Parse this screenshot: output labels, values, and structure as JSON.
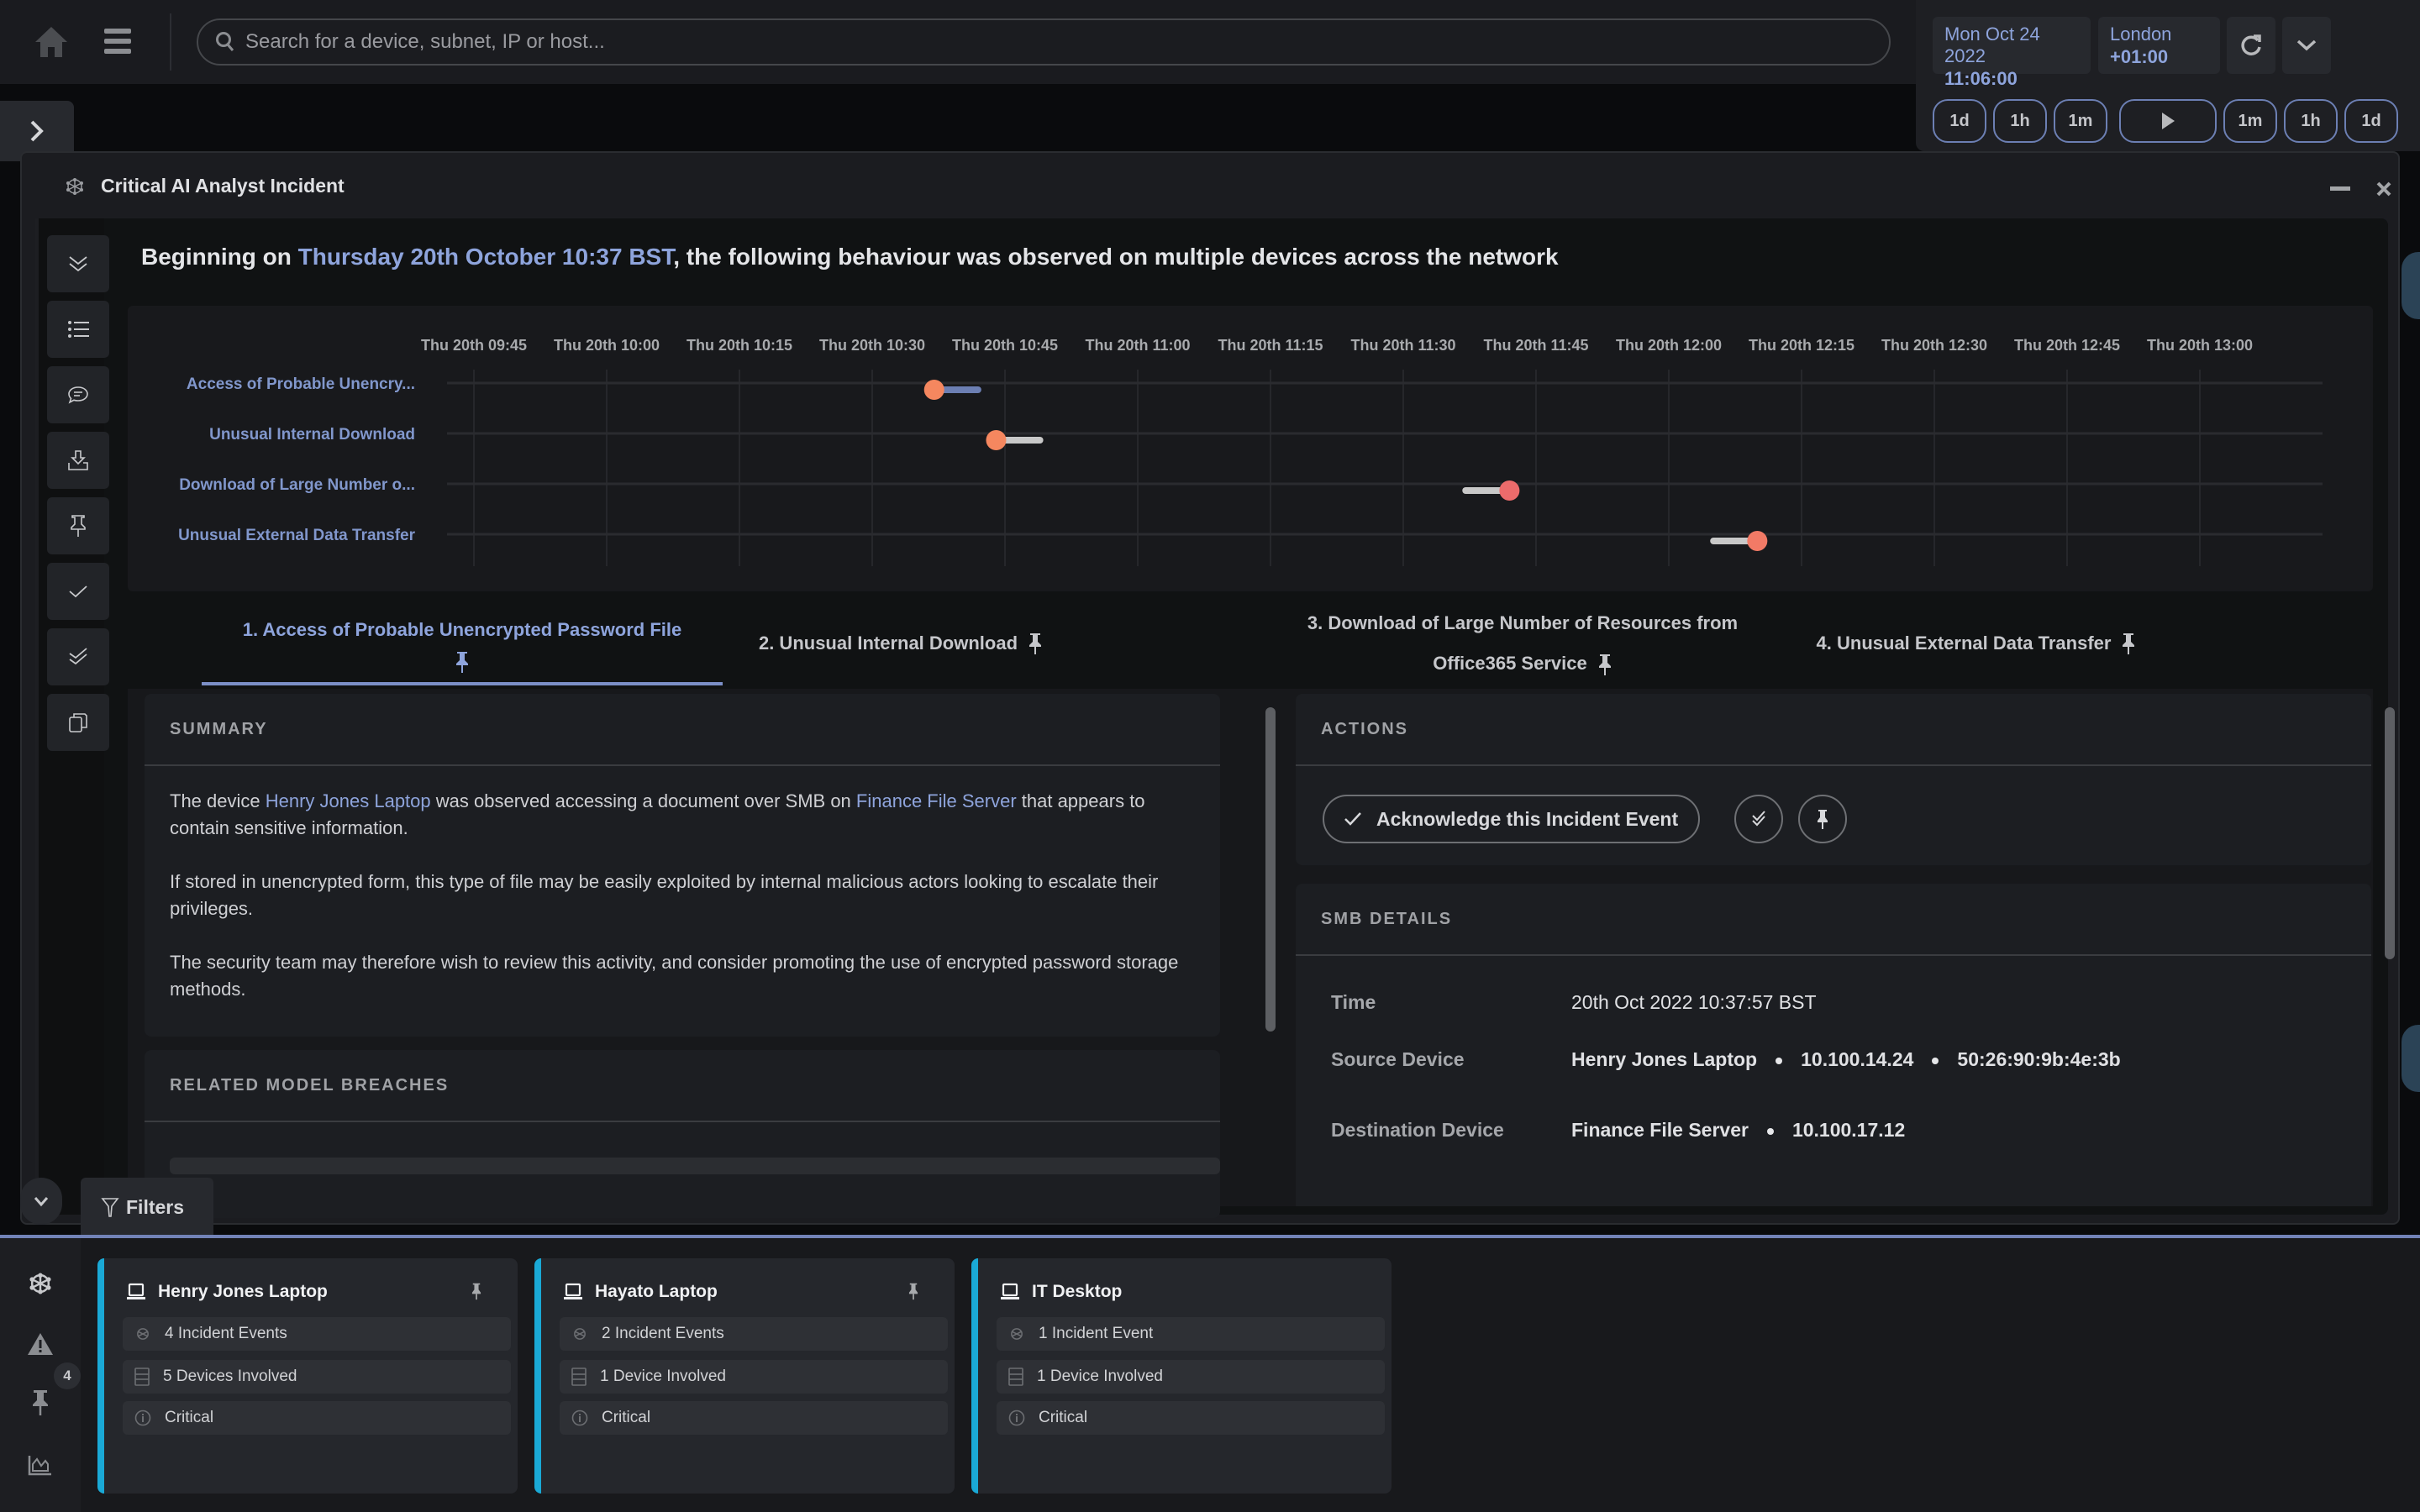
{
  "topbar": {
    "search_placeholder": "Search for a device, subnet, IP or host...",
    "date": "Mon Oct 24 2022",
    "time": "11:06:00",
    "timezone_city": "London",
    "timezone_offset": "+01:00",
    "step_back": [
      "1d",
      "1h",
      "1m"
    ],
    "step_forward": [
      "1m",
      "1h",
      "1d"
    ]
  },
  "modal": {
    "title": "Critical AI Analyst Incident",
    "headline_prefix": "Beginning on ",
    "headline_date": "Thursday 20th October 10:37 BST",
    "headline_suffix": ", the following behaviour was observed on multiple devices across the network"
  },
  "chart_data": {
    "type": "timeline",
    "x_ticks": [
      "Thu 20th 09:45",
      "Thu 20th 10:00",
      "Thu 20th 10:15",
      "Thu 20th 10:30",
      "Thu 20th 10:45",
      "Thu 20th 11:00",
      "Thu 20th 11:15",
      "Thu 20th 11:30",
      "Thu 20th 11:45",
      "Thu 20th 12:00",
      "Thu 20th 12:15",
      "Thu 20th 12:30",
      "Thu 20th 12:45",
      "Thu 20th 13:00"
    ],
    "x_range_minutes": [
      0,
      195
    ],
    "categories": [
      "Access of Probable Unencry...",
      "Unusual Internal Download",
      "Download of Large Number o...",
      "Unusual External Data Transfer"
    ],
    "events": [
      {
        "category": 0,
        "start_min": 52,
        "end_min": 56,
        "marker": "start",
        "marker_color": "#f5875f",
        "bar_color": "#6c7fb3"
      },
      {
        "category": 1,
        "start_min": 59,
        "end_min": 63,
        "marker": "start",
        "marker_color": "#f5875f",
        "bar_color": "#c8c8c8"
      },
      {
        "category": 2,
        "start_min": 113,
        "end_min": 117,
        "marker": "end",
        "marker_color": "#ec6b6b",
        "bar_color": "#c8c8c8"
      },
      {
        "category": 3,
        "start_min": 141,
        "end_min": 145,
        "marker": "end",
        "marker_color": "#f27a66",
        "bar_color": "#c8c8c8"
      }
    ],
    "grid": true
  },
  "tabs": [
    {
      "label": "1. Access of Probable Unencrypted Password File",
      "active": true
    },
    {
      "label": "2. Unusual Internal Download",
      "active": false
    },
    {
      "label_line1": "3. Download of Large Number of Resources from",
      "label_line2": "Office365 Service",
      "active": false
    },
    {
      "label": "4. Unusual External Data Transfer",
      "active": false
    }
  ],
  "summary": {
    "heading": "SUMMARY",
    "p1_a": "The device ",
    "p1_link1": "Henry Jones Laptop",
    "p1_b": " was observed accessing a document over SMB on ",
    "p1_link2": "Finance File Server",
    "p1_c": " that appears to contain sensitive information.",
    "p2": "If stored in unencrypted form, this type of file may be easily exploited by internal malicious actors looking to escalate their privileges.",
    "p3": "The security team may therefore wish to review this activity, and consider promoting the use of encrypted password storage methods."
  },
  "related": {
    "heading": "RELATED MODEL BREACHES"
  },
  "actions": {
    "heading": "ACTIONS",
    "acknowledge_label": "Acknowledge this Incident Event"
  },
  "smb": {
    "heading": "SMB DETAILS",
    "time_label": "Time",
    "time_value": "20th Oct 2022 10:37:57 BST",
    "source_label": "Source Device",
    "source_name": "Henry Jones Laptop",
    "source_ip": "10.100.14.24",
    "source_mac": "50:26:90:9b:4e:3b",
    "dest_label": "Destination Device",
    "dest_name": "Finance File Server",
    "dest_ip": "10.100.17.12"
  },
  "filters_label": "Filters",
  "tray": {
    "pinned_count": "4",
    "accent_color": "#1aa9d6",
    "cards": [
      {
        "name": "Henry Jones Laptop",
        "events": "4 Incident Events",
        "devices": "5 Devices Involved",
        "severity": "Critical",
        "pinned": true
      },
      {
        "name": "Hayato Laptop",
        "events": "2 Incident Events",
        "devices": "1 Device Involved",
        "severity": "Critical",
        "pinned": true
      },
      {
        "name": "IT Desktop",
        "events": "1 Incident Event",
        "devices": "1 Device Involved",
        "severity": "Critical",
        "pinned": false
      }
    ]
  }
}
